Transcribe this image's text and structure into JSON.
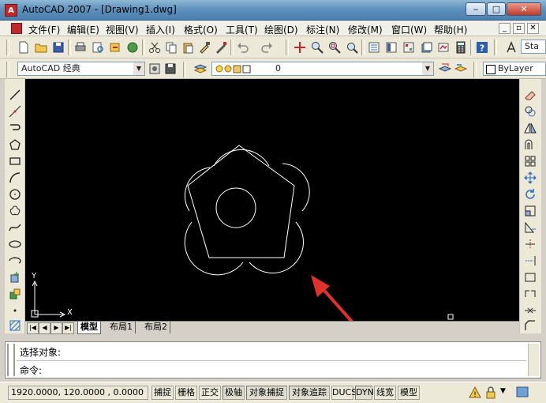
{
  "window": {
    "title": "AutoCAD 2007 - [Drawing1.dwg]",
    "app_icon_letter": "A",
    "controls": {
      "minimize": "‒",
      "maximize": "□",
      "close": "✕"
    }
  },
  "menubar": {
    "items": [
      "文件(F)",
      "编辑(E)",
      "视图(V)",
      "插入(I)",
      "格式(O)",
      "工具(T)",
      "绘图(D)",
      "标注(N)",
      "修改(M)",
      "窗口(W)",
      "帮助(H)"
    ],
    "mdi_controls": [
      "_",
      "▫",
      "✕"
    ]
  },
  "toolbar1": {
    "style_combo": "Sta"
  },
  "toolbar2": {
    "workspace": "AutoCAD 经典",
    "layer": "0",
    "linetype": "ByLayer"
  },
  "layout_tabs": [
    "模型",
    "布局1",
    "布局2"
  ],
  "ucs": {
    "x_label": "X",
    "y_label": "Y"
  },
  "command": {
    "history": "选择对象:",
    "prompt": "命令:"
  },
  "status": {
    "coordinates": "1920.0000, 120.0000 , 0.0000",
    "toggles": [
      "捕捉",
      "栅格",
      "正交",
      "极轴",
      "对象捕捉",
      "对象追踪",
      "DUCS",
      "DYN",
      "线宽",
      "模型"
    ]
  },
  "colors": {
    "canvas": "#000000",
    "geometry": "#ffffff",
    "annotation_arrow": "#e0312a"
  }
}
